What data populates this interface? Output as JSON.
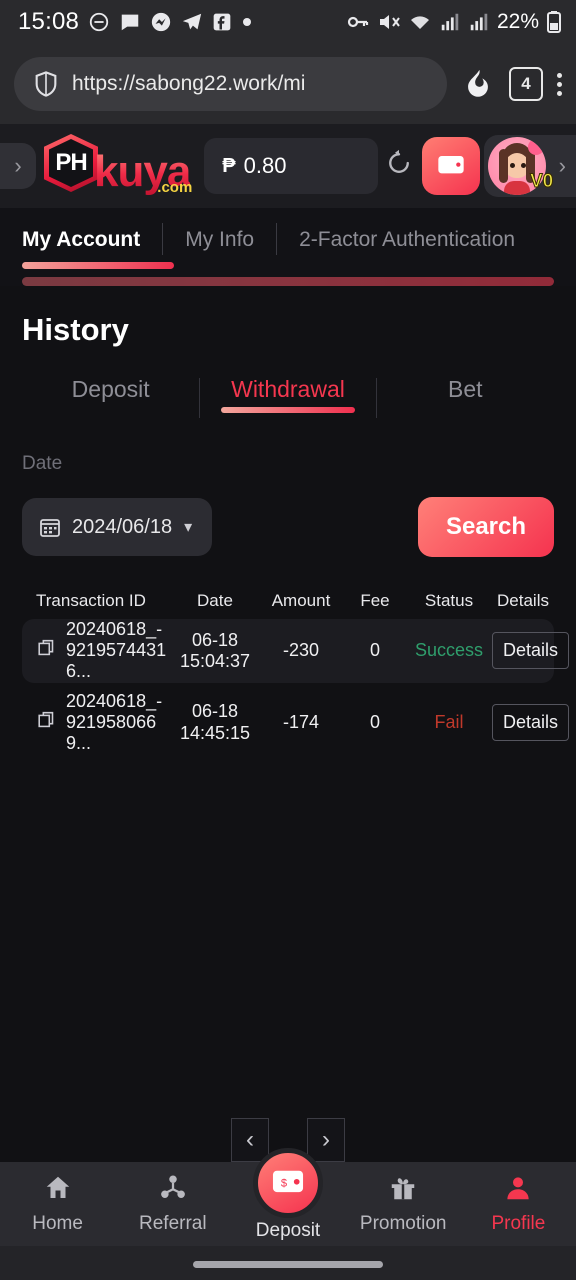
{
  "status_bar": {
    "time": "15:08",
    "battery": "22%",
    "left_icons": [
      "do-not-disturb-icon",
      "messages-icon",
      "messenger-icon",
      "telegram-icon",
      "facebook-icon",
      "dot-icon"
    ],
    "right_icons": [
      "vpn-key-icon",
      "mute-icon",
      "wifi-icon",
      "signal-one-icon",
      "signal-two-icon",
      "battery-icon"
    ]
  },
  "browser": {
    "url": "https://sabong22.work/mi",
    "shield_icon": "shield-icon",
    "flame_icon": "flame-icon",
    "tab_count": "4",
    "menu_icon": "overflow-menu-icon"
  },
  "app_header": {
    "logo_mark": "PH",
    "logo_word": "kuya",
    "logo_tld": ".com",
    "currency_symbol": "₱",
    "balance": "0.80",
    "refresh_icon": "refresh-icon",
    "wallet_icon": "wallet-icon",
    "vip_badge": "V0",
    "expand_icon": "chevron-right-icon"
  },
  "top_tabs": [
    {
      "label": "My Account",
      "active": true
    },
    {
      "label": "My Info",
      "active": false
    },
    {
      "label": "2-Factor Authentication",
      "active": false
    }
  ],
  "page": {
    "title": "History"
  },
  "sub_tabs": [
    {
      "label": "Deposit",
      "active": false
    },
    {
      "label": "Withdrawal",
      "active": true
    },
    {
      "label": "Bet",
      "active": false
    }
  ],
  "filter": {
    "date_label": "Date",
    "calendar_icon": "calendar-icon",
    "date_value": "2024/06/18",
    "chevron_icon": "chevron-down-icon",
    "search_label": "Search"
  },
  "table": {
    "columns": [
      "Transaction ID",
      "Date",
      "Amount",
      "Fee",
      "Status",
      "Details"
    ],
    "rows": [
      {
        "copy_icon": "copy-icon",
        "transaction_id": "20240618_-92195744316...",
        "date": "06-18 15:04:37",
        "amount": "-230",
        "fee": "0",
        "status": "Success",
        "status_type": "success",
        "details_label": "Details"
      },
      {
        "copy_icon": "copy-icon",
        "transaction_id": "20240618_-9219580669...",
        "date": "06-18 14:45:15",
        "amount": "-174",
        "fee": "0",
        "status": "Fail",
        "status_type": "fail",
        "details_label": "Details"
      }
    ]
  },
  "pagination": {
    "prev_icon": "chevron-left-icon",
    "next_icon": "chevron-right-icon"
  },
  "bottom_nav": [
    {
      "label": "Home",
      "icon": "home-icon",
      "active": false
    },
    {
      "label": "Referral",
      "icon": "referral-icon",
      "active": false
    },
    {
      "label": "Deposit",
      "icon": "wallet-icon",
      "active": false
    },
    {
      "label": "Promotion",
      "icon": "gift-icon",
      "active": false
    },
    {
      "label": "Profile",
      "icon": "person-icon",
      "active": true
    }
  ],
  "colors": {
    "accent_red": "#f5334f",
    "accent_light": "#ff8078",
    "success_green": "#2f9e6c",
    "fail_red": "#c0392b",
    "badge_yellow": "#f3ec4a",
    "page_bg": "#121216"
  }
}
